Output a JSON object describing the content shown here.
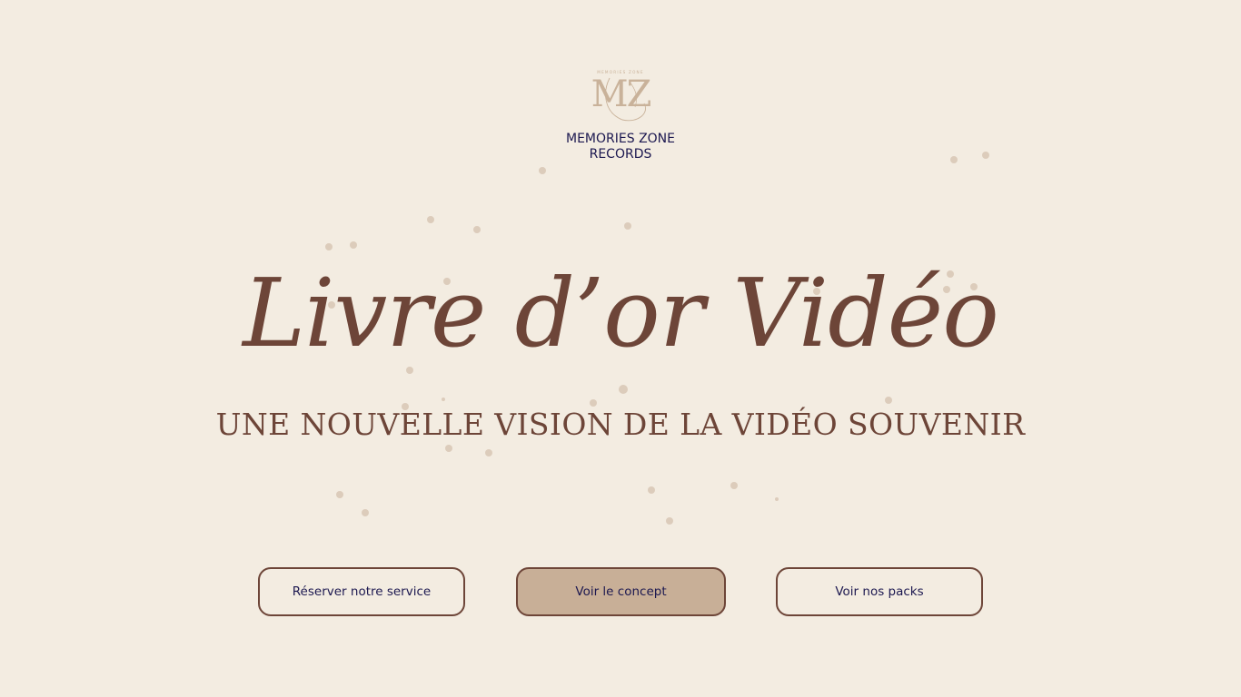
{
  "brand": {
    "logo_small_text": "MEMORIES ZONE",
    "logo_monogram": "MZ",
    "name_line1": "MEMORIES ZONE",
    "name_line2": "RECORDS"
  },
  "hero": {
    "title": "Livre d’or Vidéo",
    "subtitle": "UNE NOUVELLE VISION DE LA VIDÉO SOUVENIR"
  },
  "buttons": {
    "reserve": "Réserver notre service",
    "concept": "Voir le concept",
    "packs": "Voir nos packs"
  },
  "colors": {
    "background": "#f3ece1",
    "accent_brown": "#6d4538",
    "navy_text": "#1c1850",
    "highlight_button": "#c8af97",
    "gold_logo": "#c9b29a"
  }
}
